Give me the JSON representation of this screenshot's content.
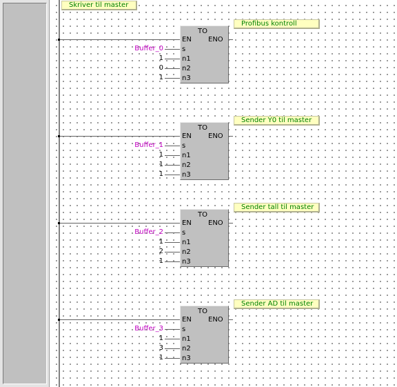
{
  "section_comment": "Skriver til master",
  "rungs": [
    {
      "comment": "Profibus kontroll",
      "instruction": "TO",
      "en": "EN",
      "eno": "ENO",
      "pins": [
        "s",
        "n1",
        "n2",
        "n3"
      ],
      "args": [
        "Buffer_0",
        "1",
        "0",
        "1"
      ]
    },
    {
      "comment": "Sender Y0 til master",
      "instruction": "TO",
      "en": "EN",
      "eno": "ENO",
      "pins": [
        "s",
        "n1",
        "n2",
        "n3"
      ],
      "args": [
        "Buffer_1",
        "1",
        "1",
        "1"
      ]
    },
    {
      "comment": "Sender tall til master",
      "instruction": "TO",
      "en": "EN",
      "eno": "ENO",
      "pins": [
        "s",
        "n1",
        "n2",
        "n3"
      ],
      "args": [
        "Buffer_2",
        "1",
        "2",
        "1"
      ]
    },
    {
      "comment": "Sender AD til master",
      "instruction": "TO",
      "en": "EN",
      "eno": "ENO",
      "pins": [
        "s",
        "n1",
        "n2",
        "n3"
      ],
      "args": [
        "Buffer_3",
        "1",
        "3",
        "1"
      ]
    }
  ],
  "colors": {
    "comment_bg": "#ffffc0",
    "comment_text": "#008000",
    "variable_text": "#c000c0",
    "block_fill": "#c0c0c0"
  }
}
